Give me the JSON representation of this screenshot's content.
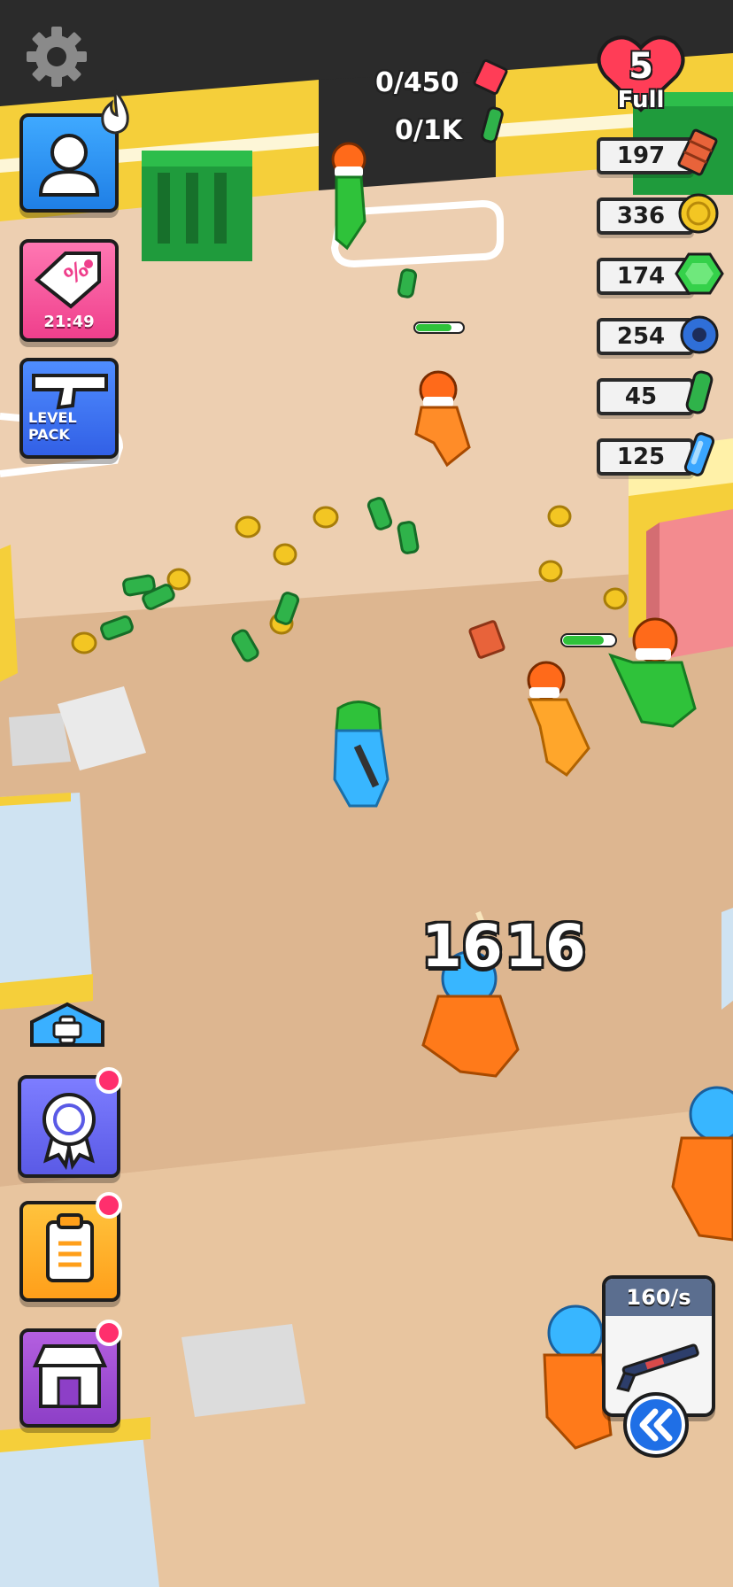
{
  "hud": {
    "lives": {
      "count": "5",
      "status": "Full",
      "color": "#ff3d57"
    },
    "sale_timer": "21:49",
    "level_pack_label": "LEVEL\nPACK",
    "capacity_counters": [
      {
        "value": "0/450",
        "icon": "brick-icon"
      },
      {
        "value": "0/1K",
        "icon": "cash-icon"
      }
    ],
    "resources": [
      {
        "value": "197",
        "icon": "brick-icon",
        "color": "#e8633a"
      },
      {
        "value": "336",
        "icon": "gold-coin-icon",
        "color": "#f3c623"
      },
      {
        "value": "174",
        "icon": "green-gem-icon",
        "color": "#35d14a"
      },
      {
        "value": "254",
        "icon": "duct-tape-icon",
        "color": "#2f6fd8"
      },
      {
        "value": "45",
        "icon": "cash-roll-icon",
        "color": "#2fb34a"
      },
      {
        "value": "125",
        "icon": "blue-crystal-icon",
        "color": "#3aa6ff"
      }
    ],
    "weapon": {
      "rate": "160/s",
      "icon": "shotgun-icon"
    }
  },
  "combat": {
    "damage_numbers": [
      "16",
      "16"
    ]
  },
  "colors": {
    "floor": "#e9c7a4",
    "wall_top": "#2b2b2b",
    "wall_yellow": "#f5cf3a",
    "prisoner_orange": "#ff7a1a",
    "guard_blue": "#38b6ff",
    "green_npc": "#2fc23a"
  }
}
